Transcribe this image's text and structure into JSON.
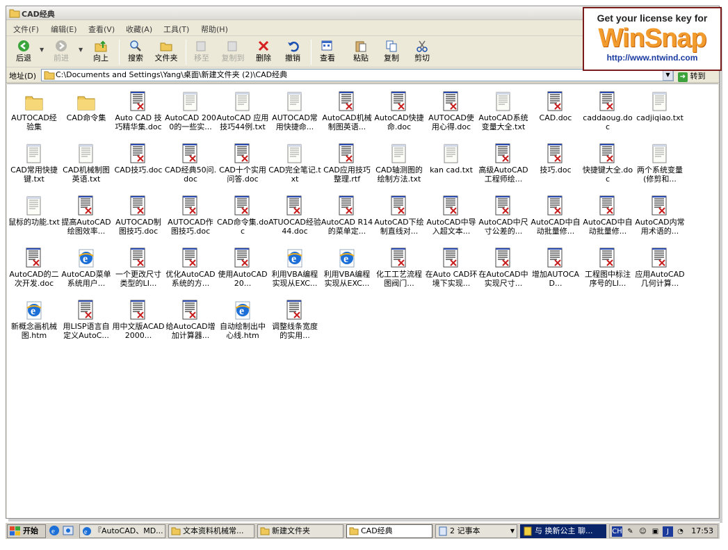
{
  "window": {
    "title": "CAD经典"
  },
  "menubar": [
    "文件(F)",
    "编辑(E)",
    "查看(V)",
    "收藏(A)",
    "工具(T)",
    "帮助(H)"
  ],
  "toolbar": {
    "back": "后退",
    "forward": "前进",
    "up": "向上",
    "search": "搜索",
    "folders": "文件夹",
    "move_to": "移至",
    "copy_to": "复制到",
    "delete": "删除",
    "undo": "撤销",
    "views": "查看",
    "paste": "粘贴",
    "copy": "复制",
    "cut": "剪切"
  },
  "addressbar": {
    "label": "地址(D)",
    "path": "C:\\Documents and Settings\\Yang\\桌面\\新建文件夹 (2)\\CAD经典",
    "go_label": "转到"
  },
  "files": [
    {
      "name": "AUTOCAD经验集",
      "type": "folder"
    },
    {
      "name": "CAD命令集",
      "type": "folder"
    },
    {
      "name": "Auto CAD 技巧精华集.doc",
      "type": "doc"
    },
    {
      "name": "AutoCAD 2000的一些实...",
      "type": "txt"
    },
    {
      "name": "AutoCAD 应用技巧44例.txt",
      "type": "txt"
    },
    {
      "name": "AUTOCAD常用快捷命...",
      "type": "txt"
    },
    {
      "name": "AutoCAD机械制图英语...",
      "type": "doc"
    },
    {
      "name": "AutoCAD快捷命.doc",
      "type": "doc"
    },
    {
      "name": "AUTOCAD使用心得.doc",
      "type": "doc"
    },
    {
      "name": "AutoCAD系统变量大全.txt",
      "type": "txt"
    },
    {
      "name": "CAD.doc",
      "type": "doc"
    },
    {
      "name": "caddaoug.doc",
      "type": "doc"
    },
    {
      "name": "cadjiqiao.txt",
      "type": "txt"
    },
    {
      "name": "CAD常用快捷键.txt",
      "type": "txt"
    },
    {
      "name": "CAD机械制图英语.txt",
      "type": "txt"
    },
    {
      "name": "CAD技巧.doc",
      "type": "doc"
    },
    {
      "name": "CAD经典50问.doc",
      "type": "doc"
    },
    {
      "name": "CAD十个实用问答.doc",
      "type": "doc"
    },
    {
      "name": "CAD完全笔记.txt",
      "type": "txt"
    },
    {
      "name": "CAD应用技巧整理.rtf",
      "type": "doc"
    },
    {
      "name": "CAD轴测图的绘制方法.txt",
      "type": "txt"
    },
    {
      "name": "kan cad.txt",
      "type": "txt"
    },
    {
      "name": "高级AutoCAD工程师绘...",
      "type": "doc"
    },
    {
      "name": "技巧.doc",
      "type": "doc"
    },
    {
      "name": "快捷键大全.doc",
      "type": "doc"
    },
    {
      "name": "两个系统变量(修剪和...",
      "type": "txt"
    },
    {
      "name": "鼠标的功能.txt",
      "type": "txt"
    },
    {
      "name": "提高AutoCAD绘图效率...",
      "type": "doc"
    },
    {
      "name": "AUTOCAD制图技巧.doc",
      "type": "doc"
    },
    {
      "name": "AUTOCAD作图技巧.doc",
      "type": "doc"
    },
    {
      "name": "CAD命令集.doc",
      "type": "doc"
    },
    {
      "name": "ATUOCAD经验44.doc",
      "type": "doc"
    },
    {
      "name": "AutoCAD R14的菜单定...",
      "type": "doc"
    },
    {
      "name": "AutoCAD下绘制直线对...",
      "type": "doc"
    },
    {
      "name": "AutoCAD中导入超文本...",
      "type": "doc"
    },
    {
      "name": "AutoCAD中尺寸公差的...",
      "type": "doc"
    },
    {
      "name": "AutoCAD中自动批量修...",
      "type": "doc"
    },
    {
      "name": "AutoCAD中自动批量修...",
      "type": "doc"
    },
    {
      "name": "AutoCAD内常用术语的...",
      "type": "doc"
    },
    {
      "name": "AutoCAD的二次开发.doc",
      "type": "doc"
    },
    {
      "name": "AutoCAD菜单系统用户...",
      "type": "htm"
    },
    {
      "name": "一个更改尺寸类型的LI...",
      "type": "doc"
    },
    {
      "name": "优化AutoCAD系统的方...",
      "type": "doc"
    },
    {
      "name": "使用AutoCAD20...",
      "type": "doc"
    },
    {
      "name": "利用VBA编程实现从EXC...",
      "type": "htm"
    },
    {
      "name": "利用VBA编程实现从EXC...",
      "type": "htm"
    },
    {
      "name": "化工工艺流程图阀门...",
      "type": "doc"
    },
    {
      "name": "在Auto CAD环境下实现...",
      "type": "doc"
    },
    {
      "name": "在AutoCAD中实现尺寸...",
      "type": "doc"
    },
    {
      "name": "增加AUTOCAD...",
      "type": "doc"
    },
    {
      "name": "工程图中标注序号的LI...",
      "type": "doc"
    },
    {
      "name": "应用AutoCAD几何计算...",
      "type": "doc"
    },
    {
      "name": "新概念画机械图.htm",
      "type": "htm"
    },
    {
      "name": "用LISP语言自定义AutoC...",
      "type": "doc"
    },
    {
      "name": "用中文版ACAD2000...",
      "type": "doc"
    },
    {
      "name": "给AutoCAD增加计算器...",
      "type": "doc"
    },
    {
      "name": "自动绘制出中心线.htm",
      "type": "htm"
    },
    {
      "name": "调整线条宽度的实用...",
      "type": "doc"
    }
  ],
  "taskbar": {
    "start": "开始",
    "tasks": [
      {
        "label": "『AutoCAD、MD...",
        "icon": "ie-icon"
      },
      {
        "label": "文本资料机械常...",
        "icon": "folder-icon"
      },
      {
        "label": "新建文件夹",
        "icon": "folder-icon"
      },
      {
        "label": "CAD经典",
        "icon": "folder-icon"
      },
      {
        "label": "2 记事本",
        "icon": "notepad-icon"
      },
      {
        "label": "与 换新公主 聊...",
        "icon": "chat-icon"
      }
    ],
    "tray_lang": "CH",
    "clock": "17:53"
  },
  "watermark": {
    "line1": "Get your license key for",
    "logo": "WinSnap",
    "url": "http://www.ntwind.com"
  },
  "colors": {
    "folder": "#f0c85a",
    "doc_accent": "#c81c1c",
    "ie_blue": "#1b6fd6",
    "task_active": "#0a246a"
  }
}
